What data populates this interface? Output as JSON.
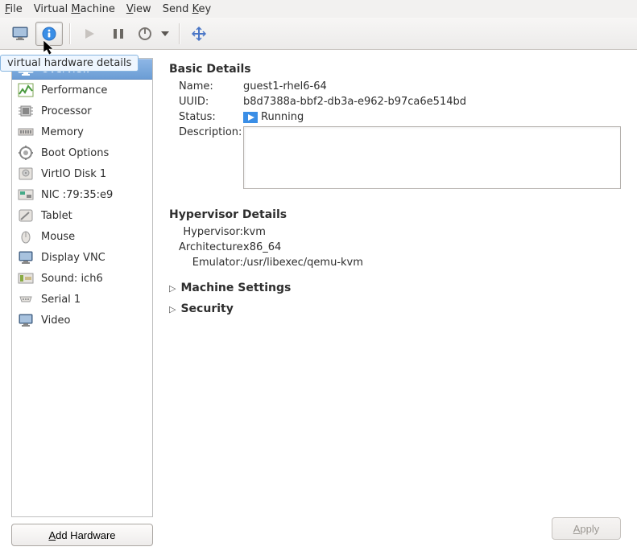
{
  "menubar": {
    "file": "File",
    "vm": "Virtual Machine",
    "view": "View",
    "sendkey": "Send Key"
  },
  "toolbar": {
    "tooltip": "virtual hardware details"
  },
  "sidebar": {
    "items": [
      {
        "label": "Overview",
        "icon": "overview"
      },
      {
        "label": "Performance",
        "icon": "performance"
      },
      {
        "label": "Processor",
        "icon": "processor"
      },
      {
        "label": "Memory",
        "icon": "memory"
      },
      {
        "label": "Boot Options",
        "icon": "boot"
      },
      {
        "label": "VirtIO Disk 1",
        "icon": "disk"
      },
      {
        "label": "NIC :79:35:e9",
        "icon": "nic"
      },
      {
        "label": "Tablet",
        "icon": "tablet"
      },
      {
        "label": "Mouse",
        "icon": "mouse"
      },
      {
        "label": "Display VNC",
        "icon": "display"
      },
      {
        "label": "Sound: ich6",
        "icon": "sound"
      },
      {
        "label": "Serial 1",
        "icon": "serial"
      },
      {
        "label": "Video",
        "icon": "video"
      }
    ],
    "add_hw": "Add Hardware"
  },
  "basic": {
    "title": "Basic Details",
    "name_k": "Name:",
    "name_v": "guest1-rhel6-64",
    "uuid_k": "UUID:",
    "uuid_v": "b8d7388a-bbf2-db3a-e962-b97ca6e514bd",
    "status_k": "Status:",
    "status_v": "Running",
    "desc_k": "Description:"
  },
  "hyper": {
    "title": "Hypervisor Details",
    "hypervisor_k": "Hypervisor:",
    "hypervisor_v": "kvm",
    "arch_k": "Architecture:",
    "arch_v": "x86_64",
    "emu_k": "Emulator:",
    "emu_v": "/usr/libexec/qemu-kvm"
  },
  "expanders": {
    "machine": "Machine Settings",
    "security": "Security"
  },
  "footer": {
    "apply": "Apply"
  }
}
